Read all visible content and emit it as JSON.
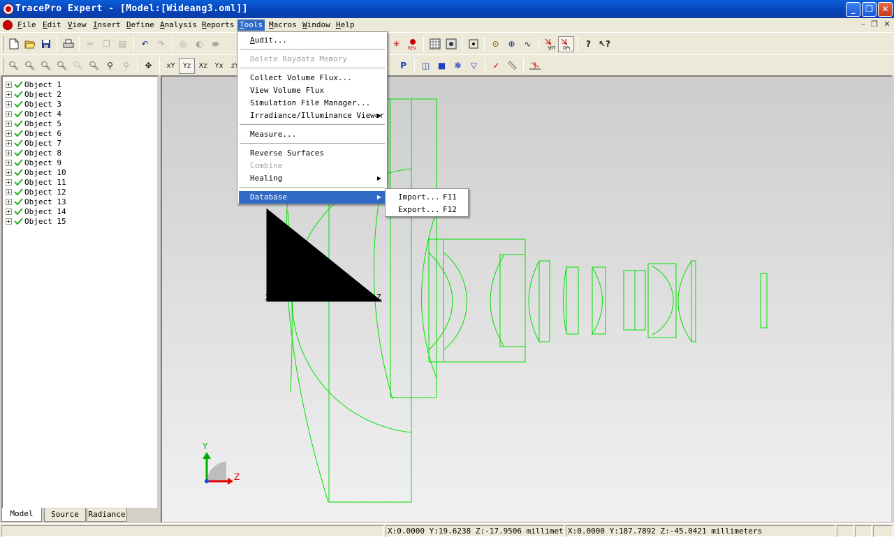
{
  "window": {
    "title": "TracePro Expert - [Model:[Wideang3.oml]]"
  },
  "window_controls": {
    "minimize": "_",
    "restore": "❐",
    "close": "✕"
  },
  "mdi_controls": {
    "minimize": "–",
    "restore": "❐",
    "close": "✕"
  },
  "menubar": {
    "items": [
      {
        "label": "File",
        "key": "F",
        "rest": "ile"
      },
      {
        "label": "Edit",
        "key": "E",
        "rest": "dit"
      },
      {
        "label": "View",
        "key": "V",
        "rest": "iew"
      },
      {
        "label": "Insert",
        "key": "I",
        "rest": "nsert"
      },
      {
        "label": "Define",
        "key": "D",
        "rest": "efine"
      },
      {
        "label": "Analysis",
        "key": "A",
        "rest": "nalysis"
      },
      {
        "label": "Reports",
        "key": "R",
        "rest": "eports"
      },
      {
        "label": "Tools",
        "key": "T",
        "rest": "ools"
      },
      {
        "label": "Macros",
        "key": "M",
        "rest": "acros"
      },
      {
        "label": "Window",
        "key": "W",
        "rest": "indow"
      },
      {
        "label": "Help",
        "key": "H",
        "rest": "elp"
      }
    ]
  },
  "toolbar2": {
    "view_buttons": [
      "xY",
      "Yz",
      "Xz",
      "Yx",
      "zY"
    ]
  },
  "tools_menu": {
    "audit": "Audit...",
    "delete_raydata": "Delete Raydata Memory",
    "collect_flux": "Collect Volume Flux...",
    "view_flux": "View Volume Flux",
    "sim_manager": "Simulation File Manager...",
    "irradiance_viewer": "Irradiance/Illuminance Viewer",
    "measure": "Measure...",
    "reverse_surfaces": "Reverse Surfaces",
    "combine": "Combine",
    "healing": "Healing",
    "database": "Database"
  },
  "database_submenu": {
    "import_label": "Import...",
    "import_shortcut": "F11",
    "export_label": "Export...",
    "export_shortcut": "F12"
  },
  "tree": {
    "items": [
      "Object 1",
      "Object 2",
      "Object 3",
      "Object 4",
      "Object 5",
      "Object 6",
      "Object 7",
      "Object 8",
      "Object 9",
      "Object 10",
      "Object 11",
      "Object 12",
      "Object 13",
      "Object 14",
      "Object 15"
    ]
  },
  "tabs": {
    "model": "Model",
    "source": "Source",
    "radiance": "Radiance"
  },
  "viewport": {
    "axis_x": "X",
    "axis_z": "Z",
    "triad_y": "Y",
    "triad_z": "Z",
    "wireframe_color": "#00e000"
  },
  "status": {
    "pane1": "X:0.0000 Y:19.6238 Z:-17.9506 millimeters",
    "pane2": "X:0.0000 Y:187.7892 Z:-45.0421 millimeters"
  }
}
